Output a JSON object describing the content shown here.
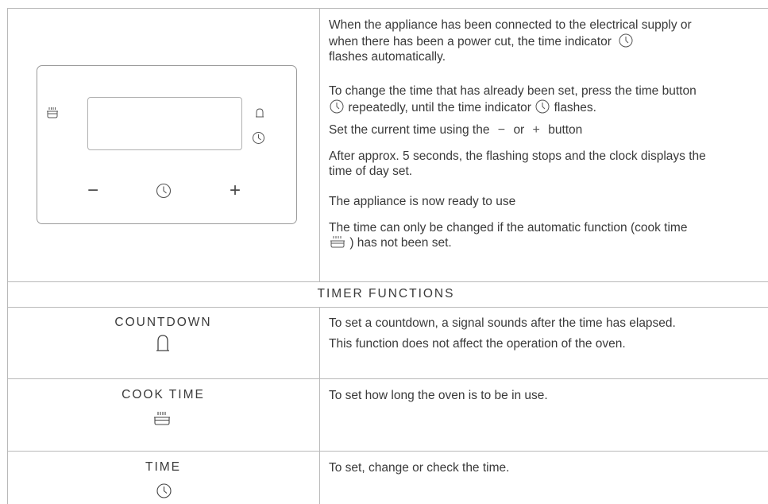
{
  "intro": {
    "p1a": "When the appliance has been connected to the electrical supply or",
    "p1b": "when there has been a power cut, the time indicator",
    "p1c": "flashes automatically.",
    "p2a": "To change the time that has already been set, press the time button",
    "p2b": "repeatedly, until the time indicator",
    "p2c": "flashes.",
    "p3a": "Set the current time using the",
    "p3minus": "−",
    "p3or": "or",
    "p3plus": "+",
    "p3b": "button",
    "p4a": "After approx. 5 seconds, the flashing stops and the clock displays the",
    "p4b": "time of day set.",
    "p5": "The appliance is now ready to use",
    "p6a": "The time can only be changed if the automatic function (cook time",
    "p6b": ") has not been set."
  },
  "panel": {
    "minus": "−",
    "plus": "+"
  },
  "section_title": "TIMER FUNCTIONS",
  "rows": [
    {
      "name": "COUNTDOWN",
      "icon": "bell-icon",
      "desc1": "To set a countdown, a signal sounds after the time has elapsed.",
      "desc2": "This function does not affect the operation of the oven."
    },
    {
      "name": "COOK TIME",
      "icon": "cook-time-icon",
      "desc1": "To set how long the oven is to be in use."
    },
    {
      "name": "TIME",
      "icon": "clock-icon",
      "desc1": "To set, change or check the time."
    }
  ]
}
